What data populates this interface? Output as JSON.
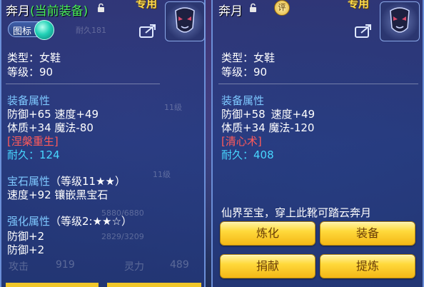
{
  "left": {
    "title": "奔月",
    "title_tag": "(当前装备)",
    "exclusive": "专用",
    "toggle_label": "图标",
    "ghost_top": "耐久181",
    "ghost_level": "11级",
    "ghost_level2": "11级",
    "ghost_hp": "5880/6880",
    "ghost_mp": "2829/3209",
    "ghost_attack_label": "攻击",
    "ghost_attack_value": "919",
    "ghost_spirit_label": "灵力",
    "ghost_spirit_value": "489",
    "type_line": "类型：女鞋",
    "level_line": "等级：90",
    "attr_header": "装备属性",
    "attr_line1": "防御+65 速度+49",
    "attr_line2": "体质+34 魔法-80",
    "special": "[涅槃重生]",
    "durability": "耐久：124",
    "gem_header": "宝石属性",
    "gem_level": "（等级11★★）",
    "gem_line": "速度+92 镶嵌黑宝石",
    "forge_header": "强化属性",
    "forge_level": "（等级2:★★☆）",
    "forge_line1": "防御+2",
    "forge_line2": "防御+2"
  },
  "right": {
    "title": "奔月",
    "badge": "评",
    "exclusive": "专用",
    "type_line": "类型：女鞋",
    "level_line": "等级：90",
    "attr_header": "装备属性",
    "attr_line1a": "防御+58",
    "attr_line1b": "速度+49",
    "attr_line2": "体质+34 魔法-120",
    "special": "[清心术]",
    "durability": "耐久：408",
    "description": "仙界至宝，穿上此靴可踏云奔月",
    "buttons": [
      "炼化",
      "装备",
      "捐献",
      "提炼"
    ]
  },
  "colors": {
    "accent_gold": "#ffdc4a",
    "green_tag": "#49f05a",
    "section_blue": "#7ec8ff",
    "special_red": "#ff5a5a",
    "durability_cyan": "#48d6ff"
  }
}
